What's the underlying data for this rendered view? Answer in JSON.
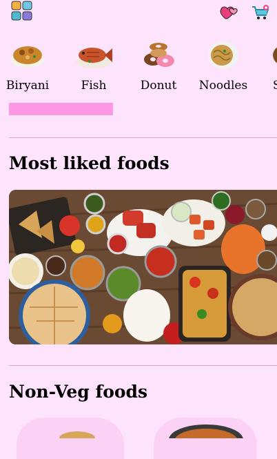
{
  "categories": [
    {
      "label": "Biryani",
      "icon": "biryani-icon"
    },
    {
      "label": "Fish",
      "icon": "fish-icon"
    },
    {
      "label": "Donut",
      "icon": "donut-icon"
    },
    {
      "label": "Noodles",
      "icon": "noodles-icon"
    },
    {
      "label": "S",
      "icon": "food-icon"
    }
  ],
  "sections": {
    "most_liked": {
      "title": "Most liked foods"
    },
    "non_veg": {
      "title": "Non-Veg foods"
    }
  },
  "colors": {
    "background": "#fde4fc",
    "indicator": "#fe98e5",
    "divider": "#d7a6d3"
  }
}
